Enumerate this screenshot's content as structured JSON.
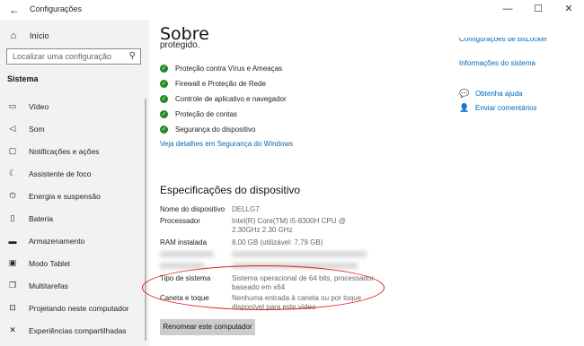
{
  "window": {
    "title": "Configurações"
  },
  "sidebar": {
    "home_label": "Início",
    "search_placeholder": "Localizar uma configuração",
    "section_label": "Sistema",
    "items": [
      {
        "label": "Vídeo",
        "icon": "monitor-icon"
      },
      {
        "label": "Som",
        "icon": "speaker-icon"
      },
      {
        "label": "Notificações e ações",
        "icon": "notification-icon"
      },
      {
        "label": "Assistente de foco",
        "icon": "moon-icon"
      },
      {
        "label": "Energia e suspensão",
        "icon": "power-icon"
      },
      {
        "label": "Bateria",
        "icon": "battery-icon"
      },
      {
        "label": "Armazenamento",
        "icon": "storage-icon"
      },
      {
        "label": "Modo Tablet",
        "icon": "tablet-icon"
      },
      {
        "label": "Multitarefas",
        "icon": "multitask-icon"
      },
      {
        "label": "Projetando neste computador",
        "icon": "project-icon"
      },
      {
        "label": "Experiências compartilhadas",
        "icon": "shared-icon"
      }
    ]
  },
  "main": {
    "title": "Sobre",
    "cut_text": "protegido.",
    "protection": [
      "Proteção contra Vírus e Ameaças",
      "Firewall e Proteção de Rede",
      "Controle de aplicativo e navegador",
      "Proteção de contas",
      "Segurança do dispositivo"
    ],
    "security_link": "Veja detalhes em Segurança do Windows",
    "specs_title": "Especificações do dispositivo",
    "specs": {
      "device_name_label": "Nome do dispositivo",
      "device_name_value": "DELLG7",
      "processor_label": "Processador",
      "processor_value": "Intel(R) Core(TM) i5-8300H CPU @ 2.30GHz 2.30 GHz",
      "ram_label": "RAM instalada",
      "ram_value": "8,00 GB (utilizável: 7,79 GB)",
      "system_type_label": "Tipo de sistema",
      "system_type_value": "Sistema operacional de 64 bits, processador baseado em x64",
      "pen_label": "Caneta e toque",
      "pen_value": "Nenhuma entrada à caneta ou por toque disponível para este vídeo"
    },
    "rename_button": "Renomear este computador"
  },
  "right": {
    "cut_link": "Configurações de BitLocker",
    "system_info_link": "Informações do sistema",
    "help_link": "Obtenha ajuda",
    "feedback_link": "Enviar comentários"
  },
  "colors": {
    "accent": "#0067b8",
    "check_green": "#1f8a1f",
    "annotation_red": "#e11b1b",
    "sidebar_bg": "#f2f2f2"
  }
}
